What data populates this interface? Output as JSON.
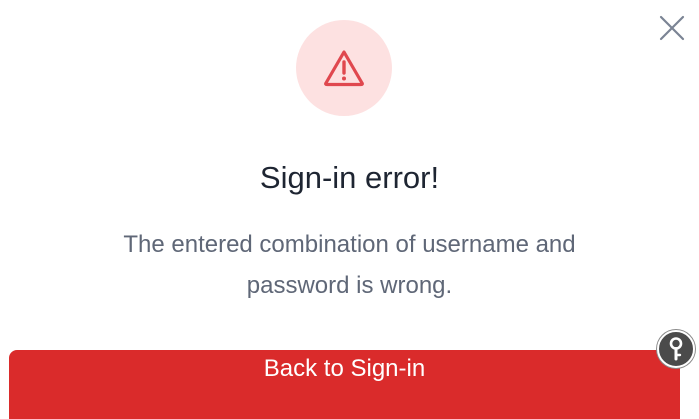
{
  "dialog": {
    "title": "Sign-in error!",
    "message_lines": [
      "The entered combination of username and",
      "password is wrong."
    ],
    "primary_button_label": "Back to Sign-in"
  },
  "icons": {
    "close": "close-icon",
    "warning": "warning-triangle-icon",
    "extension": "key-icon"
  },
  "colors": {
    "primary": "#da2b2b",
    "warning_bg": "#fde1e1",
    "warning_icon": "#e0484f",
    "title_text": "#1e2532",
    "body_text": "#5f6777"
  }
}
